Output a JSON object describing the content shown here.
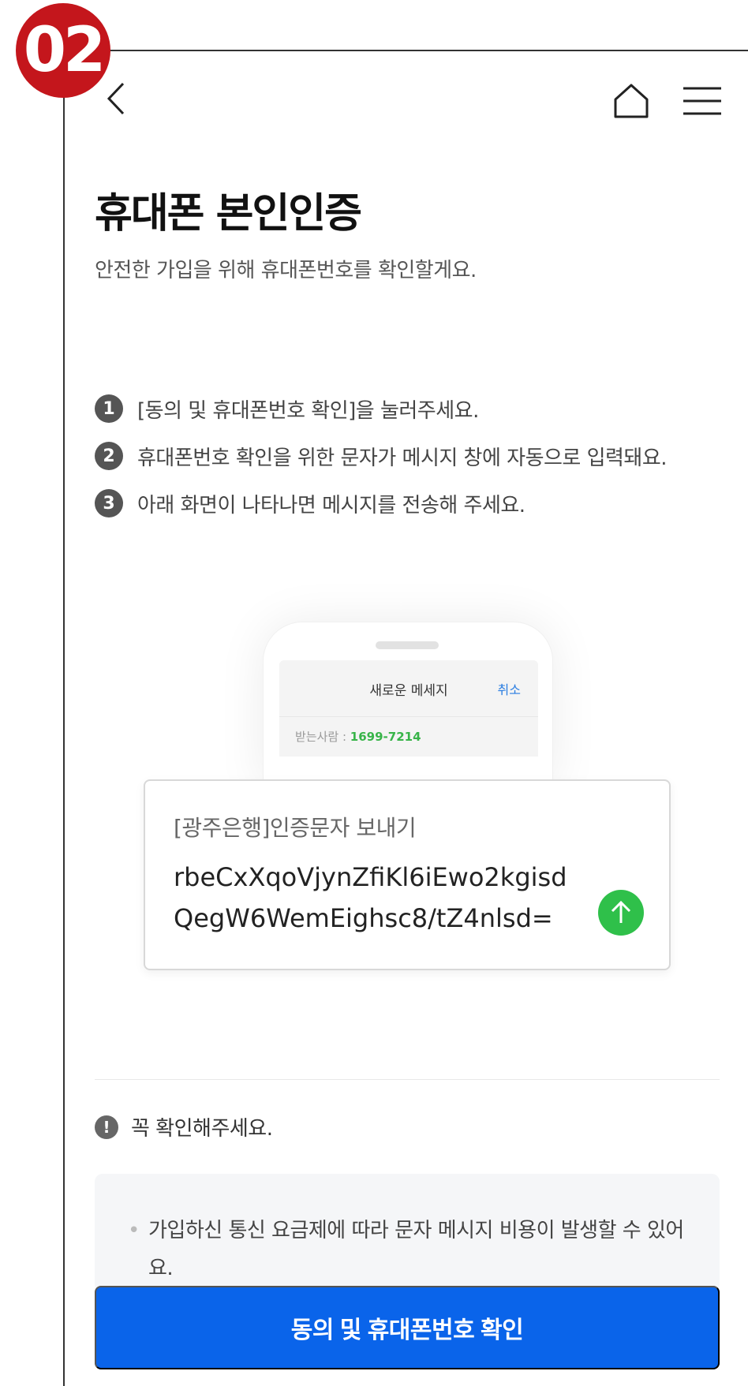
{
  "badge": {
    "label": "02"
  },
  "header": {
    "back_icon": "chevron-left-icon",
    "home_icon": "home-icon",
    "menu_icon": "hamburger-menu-icon"
  },
  "page": {
    "title": "휴대폰 본인인증",
    "subtitle": "안전한 가입을 위해 휴대폰번호를 확인할게요."
  },
  "steps": [
    {
      "num": "1",
      "text": "[동의 및 휴대폰번호 확인]을 눌러주세요."
    },
    {
      "num": "2",
      "text": "휴대폰번호 확인을 위한 문자가 메시지 창에 자동으로 입력돼요."
    },
    {
      "num": "3",
      "text": "아래 화면이 나타나면 메시지를 전송해 주세요."
    }
  ],
  "phone": {
    "header_title": "새로운 메세지",
    "cancel": "취소",
    "recipient_label": "받는사람 : ",
    "recipient_number": "1699-7214"
  },
  "message": {
    "label": "[광주은행]인증문자 보내기",
    "code": "rbeCxXqoVjynZfiKl6iEwo2kgisdQegW6WemEighsc8/tZ4nlsd=",
    "send_icon": "arrow-up-icon"
  },
  "notice": {
    "title": "꼭 확인해주세요.",
    "items": [
      "가입하신 통신 요금제에 따라 문자 메시지 비용이 발생할 수 있어요."
    ]
  },
  "cta": {
    "label": "동의 및 휴대폰번호 확인"
  },
  "colors": {
    "badge": "#c4161c",
    "primary": "#0a64ea",
    "send": "#2fc04a",
    "recipient": "#38b449",
    "cancel": "#2a7de1"
  }
}
